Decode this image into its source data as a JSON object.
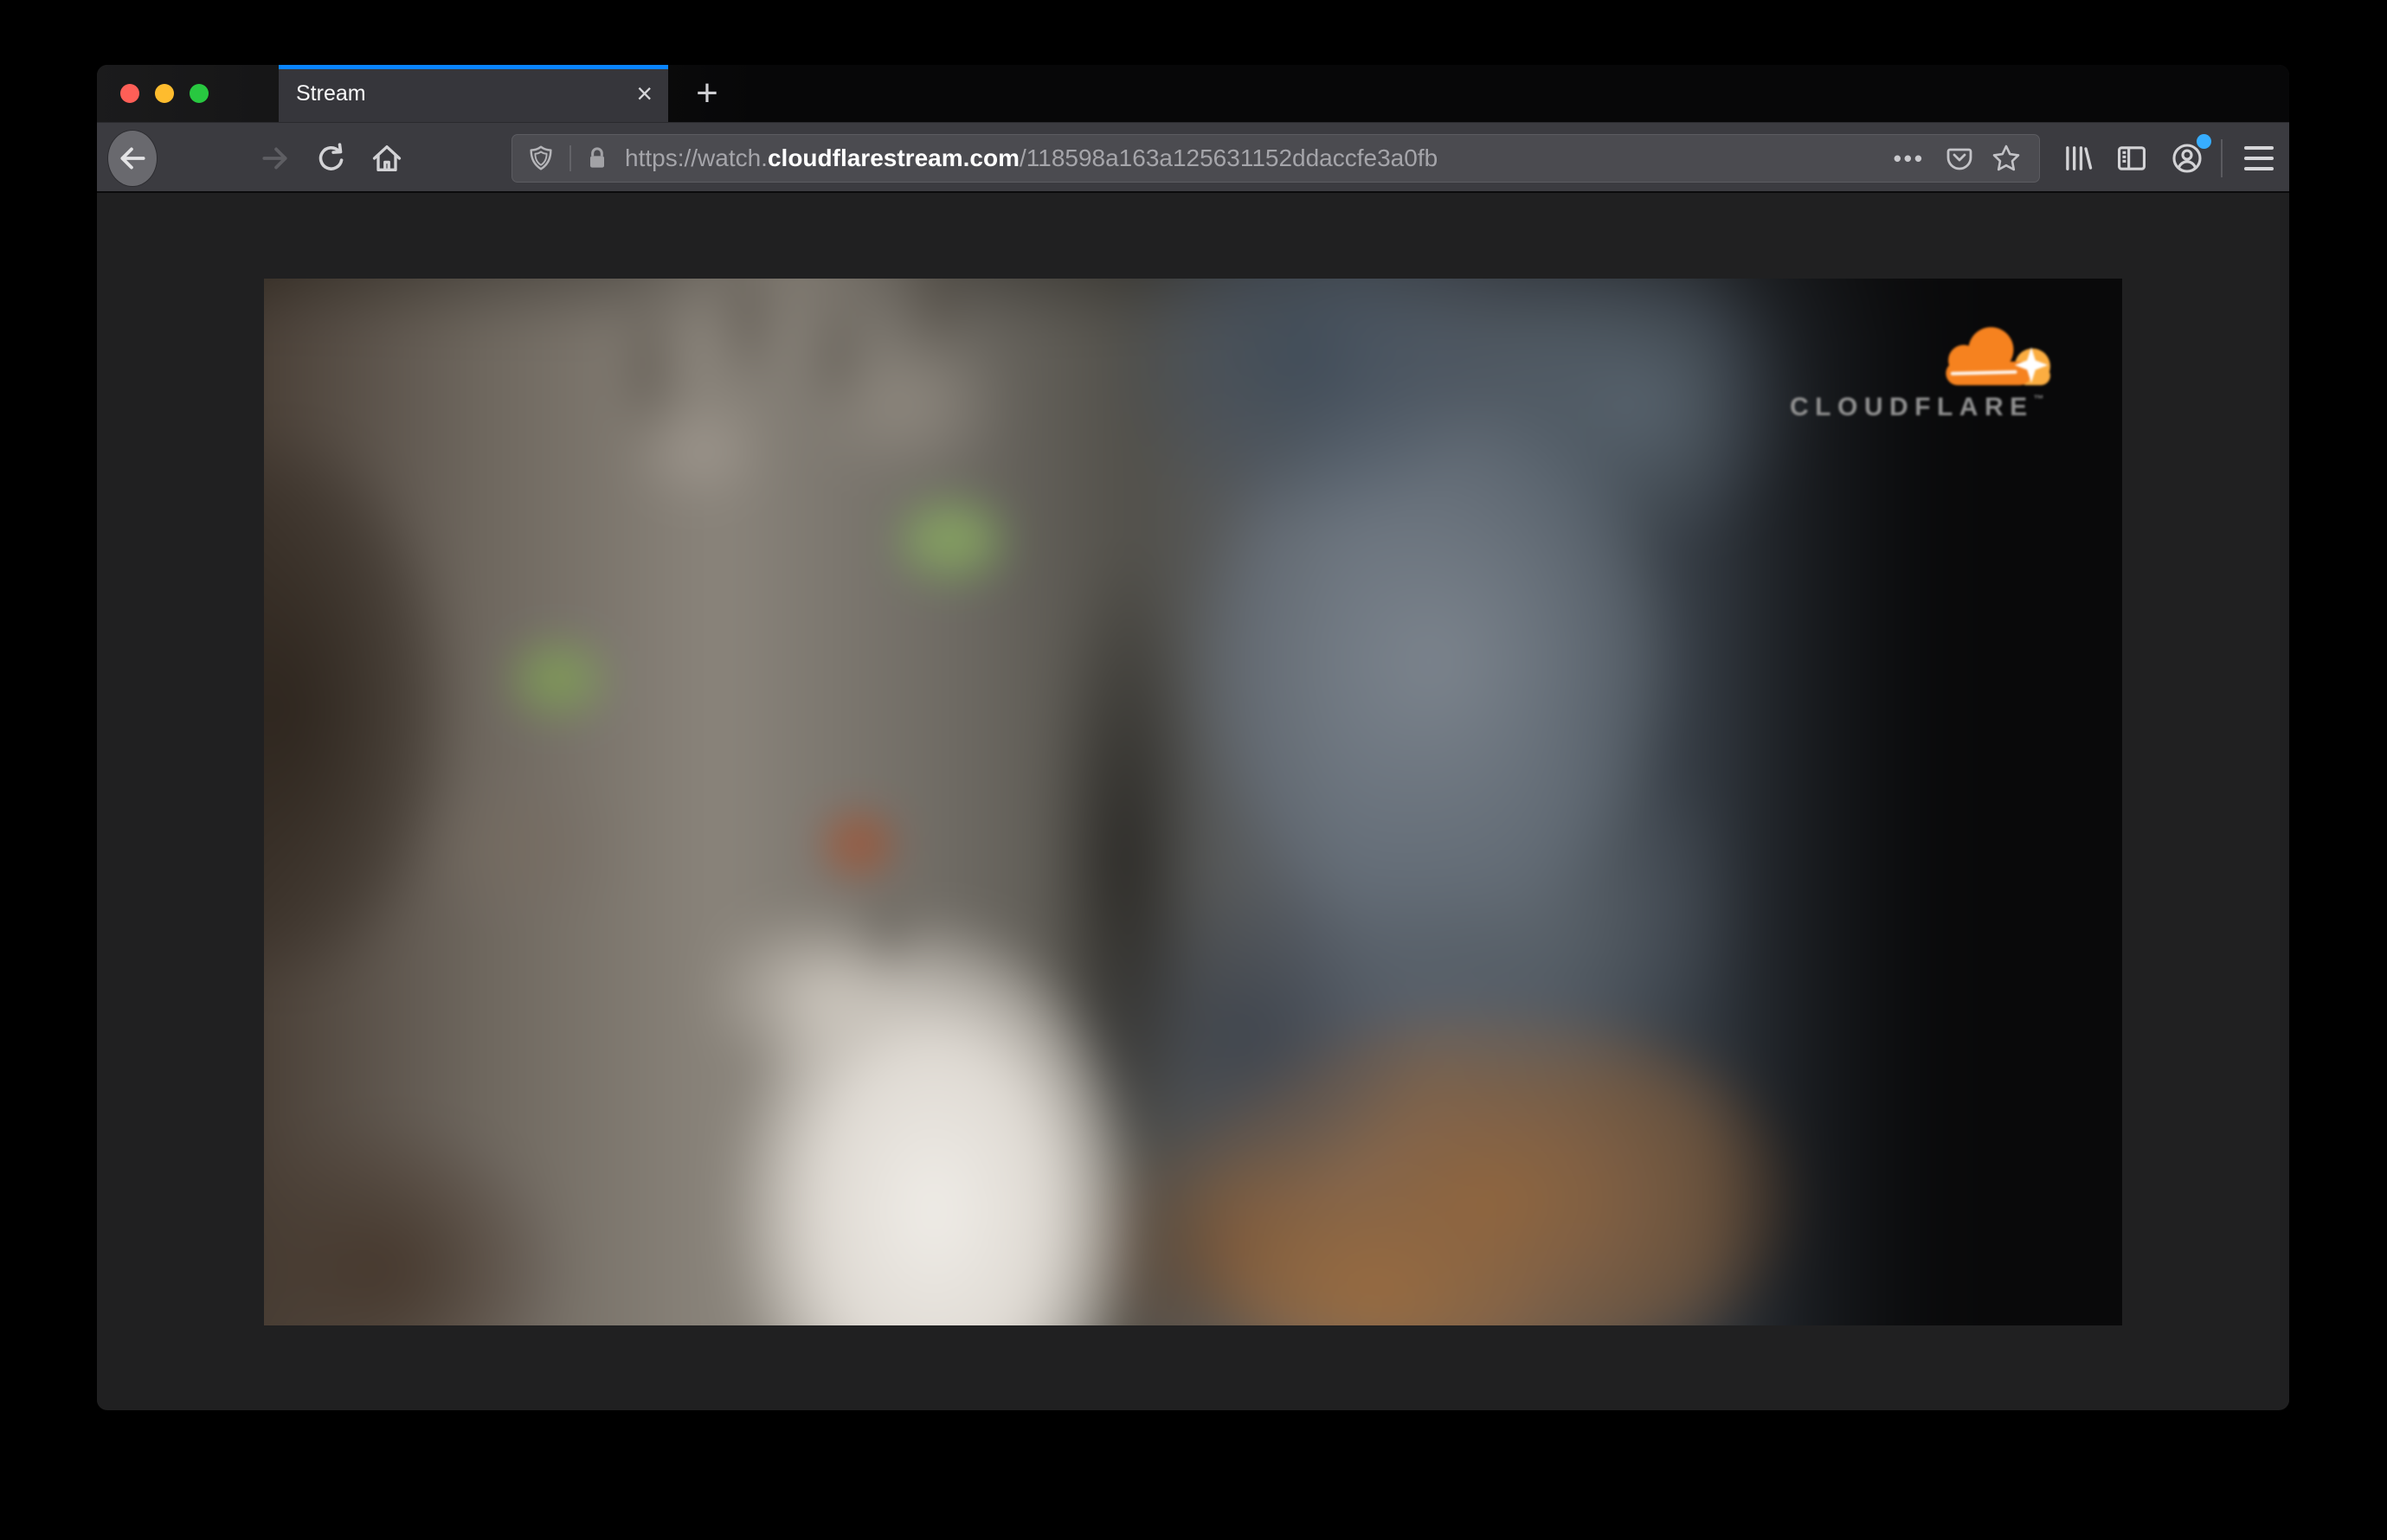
{
  "tab_bar": {
    "active_tab_title": "Stream",
    "close_tab_label": "×",
    "new_tab_label": "+"
  },
  "toolbar": {
    "url_scheme": "https://watch.",
    "url_domain": "cloudflarestream.com",
    "url_path": "/118598a163a125631152ddaccfe3a0fb",
    "page_actions_label": "•••"
  },
  "video": {
    "brand_text": "CLOUDFLARE",
    "brand_mark": "™"
  },
  "icons": {
    "window_controls": [
      "close-circle-red",
      "minimize-circle-yellow",
      "zoom-circle-green"
    ],
    "navigation": [
      "back-arrow",
      "forward-arrow",
      "reload",
      "home"
    ],
    "address_bar": [
      "tracking-protection-shield",
      "connection-lock",
      "page-actions-ellipsis",
      "pocket",
      "bookmark-star"
    ],
    "toolbar_right": [
      "library",
      "sidebar",
      "account-person",
      "menu-hamburger"
    ],
    "video_overlay": [
      "cloudflare-cloud"
    ]
  },
  "colors": {
    "accent_blue": "#0a84ff",
    "notification_blue": "#37adff",
    "cloud_orange": "#f6821f",
    "cloud_light_orange": "#fbad41",
    "traffic_red": "#ff5f57",
    "traffic_yellow": "#febc2e",
    "traffic_green": "#28c840",
    "toolbar_gray": "#3b3b40",
    "urlbar_gray": "#4b4b50"
  }
}
